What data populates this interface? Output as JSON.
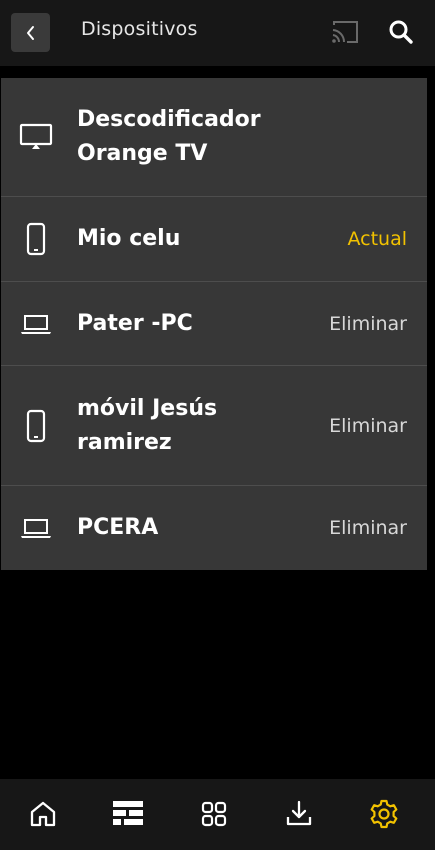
{
  "header": {
    "title": "Dispositivos",
    "back_icon": "chevron-left-icon",
    "cast_icon": "cast-icon",
    "search_icon": "search-icon"
  },
  "devices": [
    {
      "name": "Descodificador Orange TV",
      "icon": "tv-icon",
      "action": ""
    },
    {
      "name": "Mio celu",
      "icon": "smartphone-icon",
      "action": "Actual"
    },
    {
      "name": "Pater -PC",
      "icon": "laptop-icon",
      "action": "Eliminar"
    },
    {
      "name": "móvil Jesús ramirez",
      "icon": "smartphone-icon",
      "action": "Eliminar"
    },
    {
      "name": "PCERA",
      "icon": "laptop-icon",
      "action": "Eliminar"
    }
  ],
  "bottom_nav": [
    {
      "icon": "home-icon"
    },
    {
      "icon": "guide-icon"
    },
    {
      "icon": "grid-icon"
    },
    {
      "icon": "download-icon"
    },
    {
      "icon": "settings-icon",
      "active": true
    }
  ],
  "colors": {
    "accent": "#f2c200",
    "row_bg": "#373737",
    "header_bg": "#171717",
    "background": "#000000"
  }
}
